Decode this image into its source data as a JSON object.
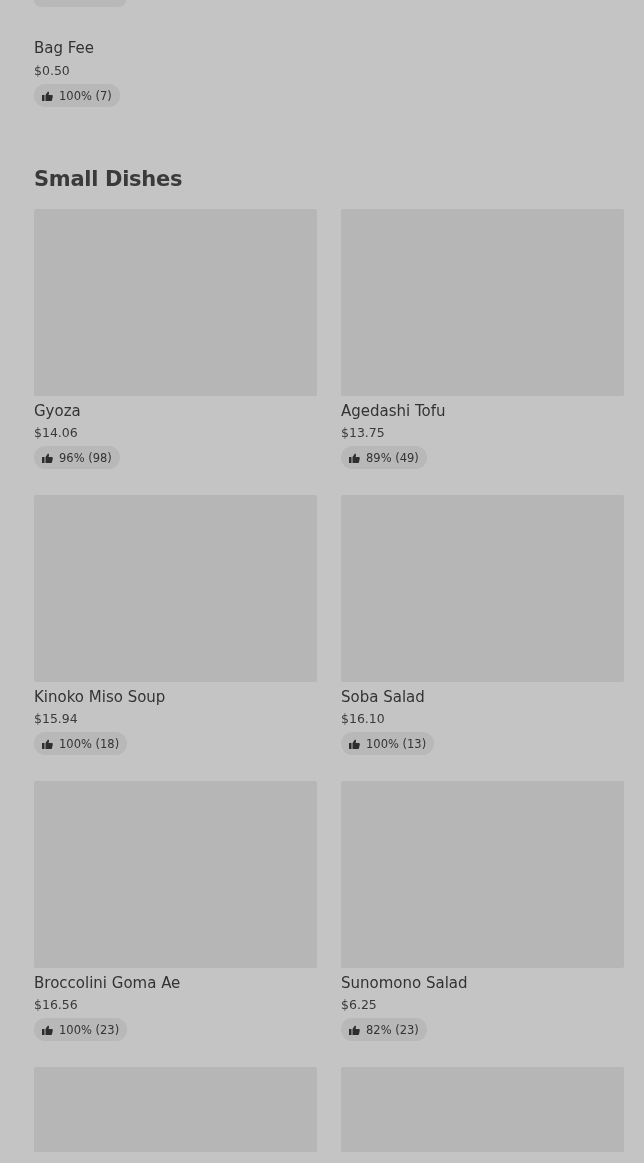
{
  "items": [
    {
      "name": "Bag Fee",
      "price": "$0.50",
      "rating": "100% (7)"
    }
  ],
  "section": {
    "title": "Small Dishes",
    "dishes": [
      {
        "kind": "dish",
        "name": "Gyoza",
        "price": "$14.06",
        "rating": "96% (98)"
      },
      {
        "kind": "dish",
        "name": "Agedashi Tofu",
        "price": "$13.75",
        "rating": "89% (49)"
      },
      {
        "kind": "dish",
        "name": "Kinoko Miso Soup",
        "price": "$15.94",
        "rating": "100% (18)"
      },
      {
        "kind": "dish",
        "name": "Soba Salad",
        "price": "$16.10",
        "rating": "100% (13)"
      },
      {
        "kind": "dish",
        "name": "Broccolini Goma Ae",
        "price": "$16.56",
        "rating": "100% (23)"
      },
      {
        "kind": "dish",
        "name": "Sunomono Salad",
        "price": "$6.25",
        "rating": "82% (23)"
      },
      {
        "kind": "image-only"
      },
      {
        "kind": "image-only"
      }
    ]
  }
}
